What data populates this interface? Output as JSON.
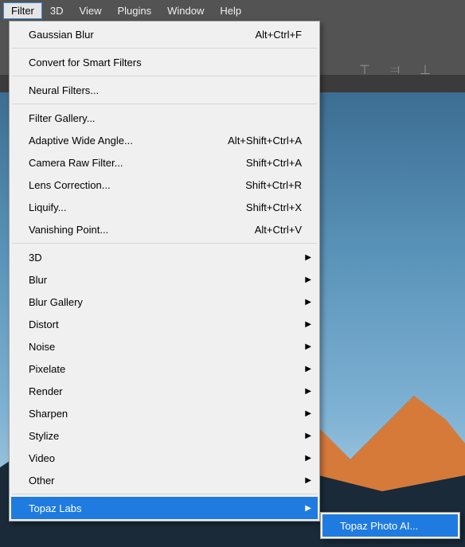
{
  "menubar": {
    "items": [
      "Filter",
      "3D",
      "View",
      "Plugins",
      "Window",
      "Help"
    ],
    "active_index": 0
  },
  "dropdown": {
    "groups": [
      [
        {
          "label": "Gaussian Blur",
          "shortcut": "Alt+Ctrl+F",
          "sub": false
        }
      ],
      [
        {
          "label": "Convert for Smart Filters",
          "shortcut": "",
          "sub": false
        }
      ],
      [
        {
          "label": "Neural Filters...",
          "shortcut": "",
          "sub": false
        }
      ],
      [
        {
          "label": "Filter Gallery...",
          "shortcut": "",
          "sub": false
        },
        {
          "label": "Adaptive Wide Angle...",
          "shortcut": "Alt+Shift+Ctrl+A",
          "sub": false
        },
        {
          "label": "Camera Raw Filter...",
          "shortcut": "Shift+Ctrl+A",
          "sub": false
        },
        {
          "label": "Lens Correction...",
          "shortcut": "Shift+Ctrl+R",
          "sub": false
        },
        {
          "label": "Liquify...",
          "shortcut": "Shift+Ctrl+X",
          "sub": false
        },
        {
          "label": "Vanishing Point...",
          "shortcut": "Alt+Ctrl+V",
          "sub": false
        }
      ],
      [
        {
          "label": "3D",
          "shortcut": "",
          "sub": true
        },
        {
          "label": "Blur",
          "shortcut": "",
          "sub": true
        },
        {
          "label": "Blur Gallery",
          "shortcut": "",
          "sub": true
        },
        {
          "label": "Distort",
          "shortcut": "",
          "sub": true
        },
        {
          "label": "Noise",
          "shortcut": "",
          "sub": true
        },
        {
          "label": "Pixelate",
          "shortcut": "",
          "sub": true
        },
        {
          "label": "Render",
          "shortcut": "",
          "sub": true
        },
        {
          "label": "Sharpen",
          "shortcut": "",
          "sub": true
        },
        {
          "label": "Stylize",
          "shortcut": "",
          "sub": true
        },
        {
          "label": "Video",
          "shortcut": "",
          "sub": true
        },
        {
          "label": "Other",
          "shortcut": "",
          "sub": true
        }
      ],
      [
        {
          "label": "Topaz Labs",
          "shortcut": "",
          "sub": true,
          "highlight": true
        }
      ]
    ]
  },
  "submenu": {
    "items": [
      {
        "label": "Topaz Photo AI...",
        "highlight": true
      }
    ]
  }
}
